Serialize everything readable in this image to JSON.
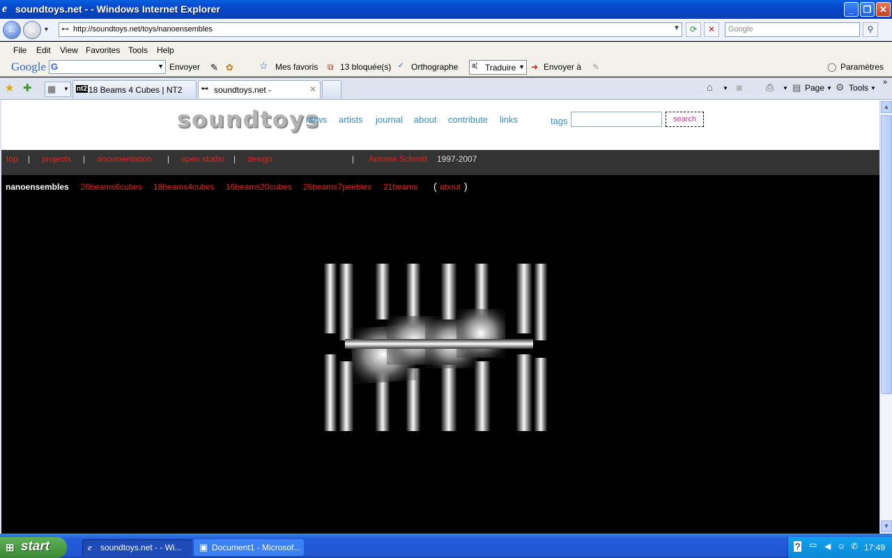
{
  "window": {
    "title": "soundtoys.net - - Windows Internet Explorer"
  },
  "address_bar": {
    "url": "http://soundtoys.net/toys/nanoensembles",
    "search_placeholder": "Google"
  },
  "menu": {
    "items": [
      "File",
      "Edit",
      "View",
      "Favorites",
      "Tools",
      "Help"
    ]
  },
  "google_toolbar": {
    "logo": "Google",
    "send_label": "Envoyer",
    "favorites_label": "Mes favoris",
    "blocked_label": "13 bloquée(s)",
    "spell_label": "Orthographe",
    "translate_label": "Traduire",
    "sendto_label": "Envoyer à",
    "settings_label": "Paramètres"
  },
  "tabs": [
    {
      "label": "18 Beams 4 Cubes | NT2",
      "icon": "nt2"
    },
    {
      "label": "soundtoys.net -",
      "icon": "soundtoys-icon"
    }
  ],
  "command_bar": {
    "page_label": "Page",
    "tools_label": "Tools"
  },
  "site": {
    "logo": "soundtoys",
    "nav": [
      "news",
      "artists",
      "journal",
      "about",
      "contribute",
      "links"
    ],
    "tags_label": "tags",
    "search_button": "search"
  },
  "subnav": {
    "items": [
      "top",
      "projects",
      "documentation",
      "open studio",
      "design"
    ],
    "separator": "|",
    "author": "Antoine Schmitt",
    "years": "1997-2007"
  },
  "toysnav": {
    "current": "nanoensembles",
    "items": [
      "26beams6cubes",
      "18beams4cubes",
      "16beams20cubes",
      "26beams7peebles",
      "21beams"
    ],
    "about_label": "about",
    "open_paren": "(",
    "close_paren": ")"
  },
  "taskbar": {
    "start_label": "start",
    "items": [
      "soundtoys.net - - Wi...",
      "Document1 - Microsof..."
    ],
    "clock": "17:49"
  },
  "colors": {
    "link_blue": "#3391c4",
    "link_red": "#e6261b",
    "search_pink": "#c0398e"
  }
}
